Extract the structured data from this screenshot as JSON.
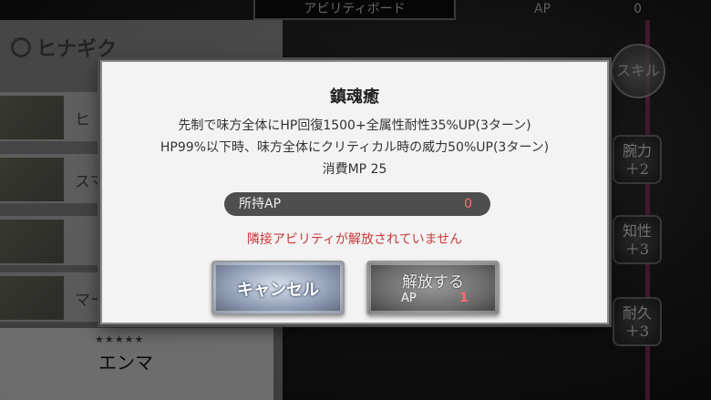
{
  "header": {
    "title": "アビリティボード",
    "ap_label": "AP",
    "ap_value": "0"
  },
  "character": {
    "name": "ヒナギク"
  },
  "ability_list": [
    {
      "label": "ヒ"
    },
    {
      "label": "スマ"
    },
    {
      "label": ""
    },
    {
      "label": "マー"
    }
  ],
  "selected_unit": {
    "stars": "★★★★★",
    "name": "エンマ"
  },
  "right_badges": {
    "skill": "スキル",
    "items": [
      {
        "label": "腕力\n＋2"
      },
      {
        "label": "知性\n＋3"
      },
      {
        "label": "耐久\n＋3"
      }
    ]
  },
  "dialog": {
    "title": "鎮魂癒",
    "description_lines": [
      "先制で味方全体にHP回復1500+全属性耐性35%UP(3ターン)",
      "HP99%以下時、味方全体にクリティカル時の威力50%UP(3ターン)",
      "消費MP 25"
    ],
    "owned_ap_label": "所持AP",
    "owned_ap_value": "0",
    "warning": "隣接アビリティが解放されていません",
    "cancel_label": "キャンセル",
    "release_label": "解放する",
    "release_cost_label": "AP",
    "release_cost_value": "1"
  },
  "colors": {
    "warning": "#c83a3a",
    "cost": "#ff6a6a",
    "accent_line": "#b2347a"
  }
}
